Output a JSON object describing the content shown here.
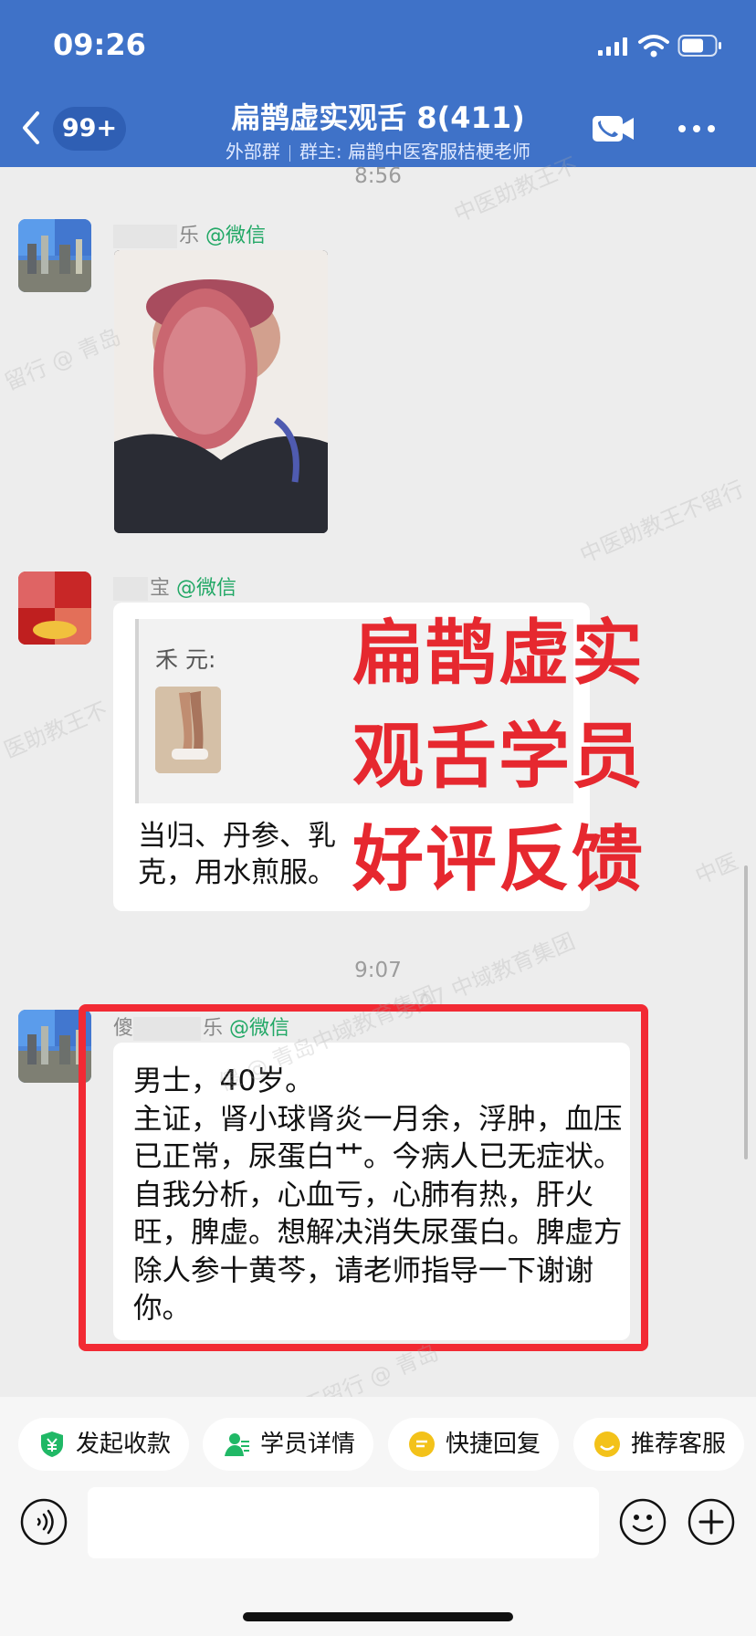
{
  "status_bar": {
    "time": "09:26"
  },
  "header": {
    "unread_badge": "99+",
    "title": "扁鹊虚实观舌 8(411)",
    "group_type": "外部群",
    "group_owner": "群主: 扁鹊中医客服桔梗老师"
  },
  "messages": [
    {
      "kind": "time",
      "text": "8:56"
    },
    {
      "kind": "image",
      "sender_visible": "乐",
      "sender_tag": "@微信",
      "icon": "tongue-photo"
    },
    {
      "kind": "reply",
      "sender_visible": "宝",
      "sender_tag": "@微信",
      "quote_author": "禾 元:",
      "reply_text": "当归、丹参、乳\n克，用水煎服。"
    },
    {
      "kind": "time",
      "text": "9:07"
    },
    {
      "kind": "text",
      "sender_visible_prefix": "傻",
      "sender_visible_suffix": "乐",
      "sender_tag": "@微信",
      "text": "男士，40岁。\n主证，肾小球肾炎一月余，浮肿，血压已正常，尿蛋白艹。今病人已无症状。自我分析，心血亏，心肺有热，肝火旺，脾虚。想解决消失尿蛋白。脾虚方除人参十黄芩，请老师指导一下谢谢你。"
    }
  ],
  "overlay": {
    "text": "扁鹊虚实\n观舌学员\n好评反馈",
    "color": "#e6282f"
  },
  "watermarks": [
    "中医助教王不",
    "留行 @ 青岛",
    "中医助教王不留行",
    "医助教王不",
    "中医",
    "9:07 中域教育集团",
    "傻 @ 青岛中域教育集团",
    "王不留行 @ 青岛"
  ],
  "quick_actions": [
    {
      "label": "发起收款",
      "icon": "payment-icon"
    },
    {
      "label": "学员详情",
      "icon": "student-icon"
    },
    {
      "label": "快捷回复",
      "icon": "quick-reply-icon"
    },
    {
      "label": "推荐客服",
      "icon": "recommend-service-icon"
    }
  ],
  "composer": {
    "placeholder": ""
  },
  "colors": {
    "header": "#3f72c8",
    "background": "#ededed",
    "accent": "#22a866",
    "highlight": "#f22a34"
  }
}
